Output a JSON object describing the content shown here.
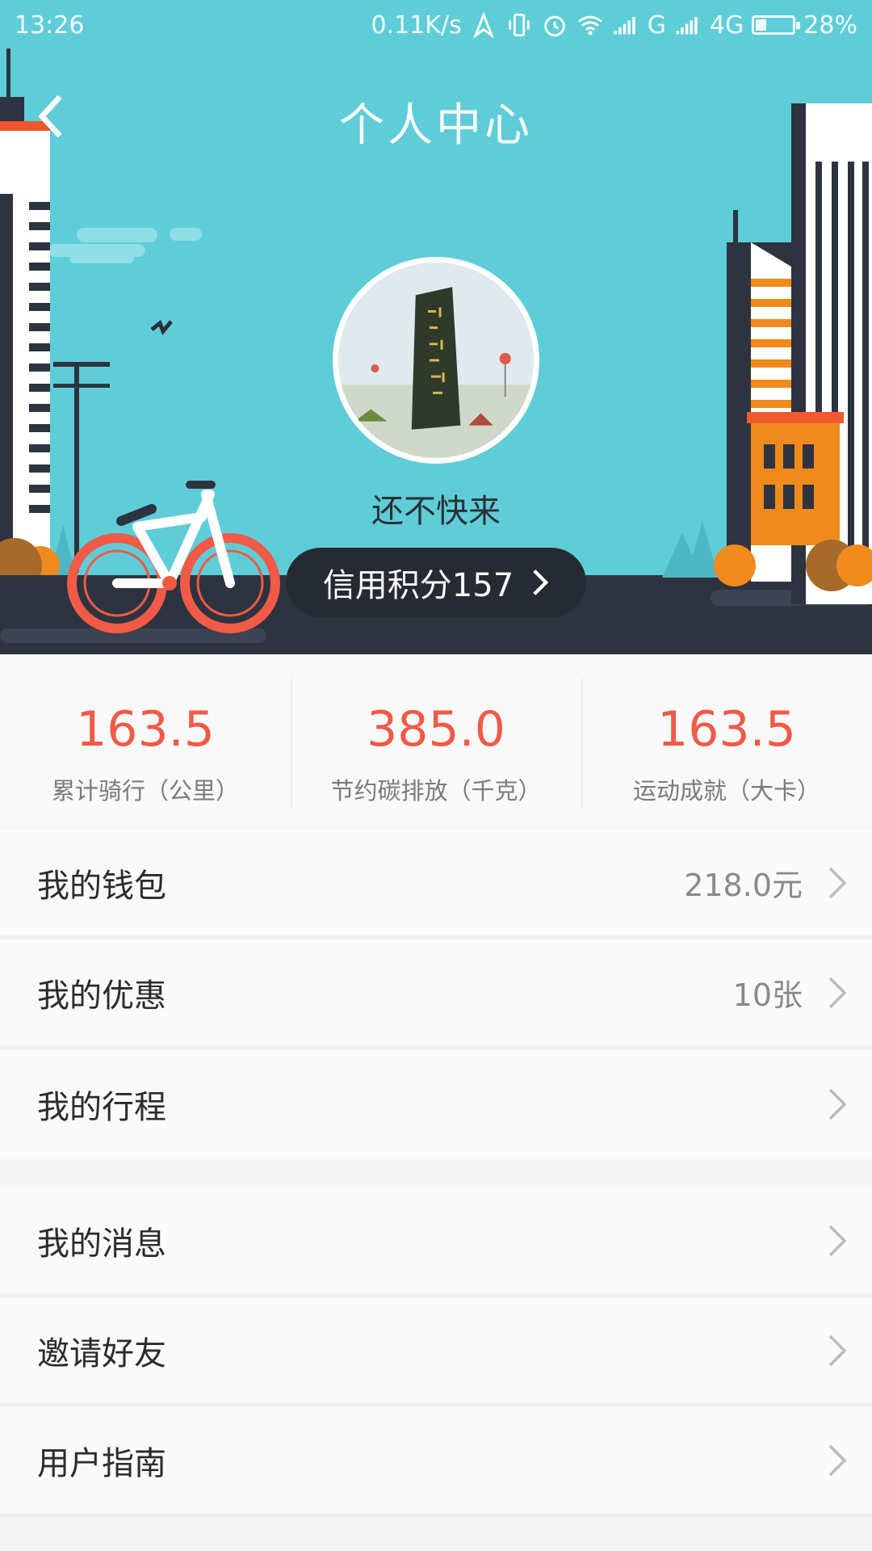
{
  "status_bar": {
    "time": "13:26",
    "net_speed": "0.11K/s",
    "signal_g": "G",
    "signal_4g": "4G",
    "battery_percent": "28%",
    "battery_level": 0.28
  },
  "header": {
    "title": "个人中心",
    "back_icon": "chevron-left-icon"
  },
  "profile": {
    "username": "还不快来",
    "credit_label": "信用积分157"
  },
  "stats": [
    {
      "value": "163.5",
      "label": "累计骑行（公里）"
    },
    {
      "value": "385.0",
      "label": "节约碳排放（千克）"
    },
    {
      "value": "163.5",
      "label": "运动成就（大卡）"
    }
  ],
  "menu_group_1": [
    {
      "label": "我的钱包",
      "value": "218.0元"
    },
    {
      "label": "我的优惠",
      "value": "10张"
    },
    {
      "label": "我的行程",
      "value": ""
    }
  ],
  "menu_group_2": [
    {
      "label": "我的消息",
      "value": ""
    },
    {
      "label": "邀请好友",
      "value": ""
    },
    {
      "label": "用户指南",
      "value": ""
    }
  ],
  "colors": {
    "hero_bg": "#5ecdd8",
    "accent_red": "#f05a47",
    "dark_pill": "#262a33"
  }
}
